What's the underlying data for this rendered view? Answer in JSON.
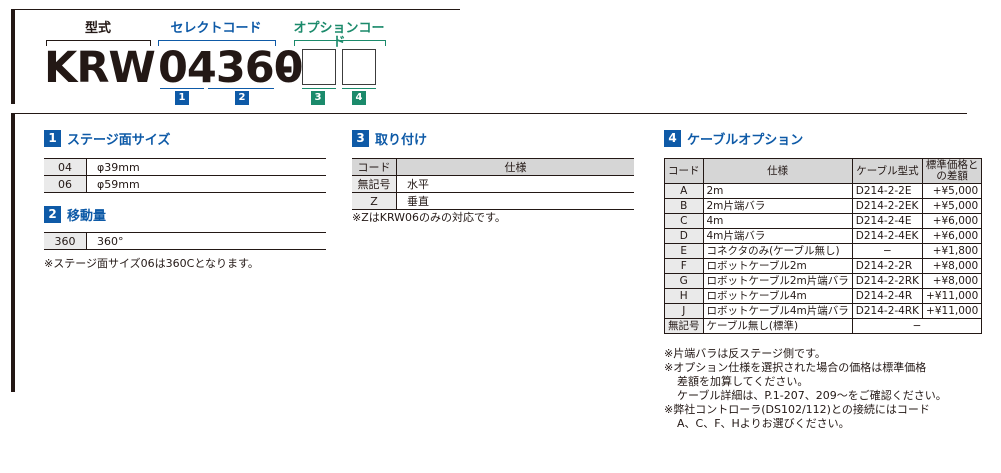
{
  "header": {
    "label_type": "型式",
    "label_select": "セレクトコード",
    "label_option": "オプションコード",
    "model_prefix": "KRW",
    "select_code": "04360",
    "dash": "-",
    "badge1": "1",
    "badge2": "2",
    "badge3": "3",
    "badge4": "4",
    "colors": {
      "blue": "#0e5aa7",
      "green": "#1b8a6b",
      "dark": "#231815"
    }
  },
  "stage_size": {
    "badge": "1",
    "title": "ステージ面サイズ",
    "rows": [
      {
        "code": "04",
        "value": "φ39mm"
      },
      {
        "code": "06",
        "value": "φ59mm"
      }
    ]
  },
  "travel": {
    "badge": "2",
    "title": "移動量",
    "rows": [
      {
        "code": "360",
        "value": "360°"
      }
    ],
    "note": "※ステージ面サイズ06は360Cとなります。"
  },
  "mounting": {
    "badge": "3",
    "title": "取り付け",
    "headers": {
      "code": "コード",
      "spec": "仕様"
    },
    "rows": [
      {
        "code": "無記号",
        "spec": "水平"
      },
      {
        "code": "Z",
        "spec": "垂直"
      }
    ],
    "note": "※ZはKRW06のみの対応です。"
  },
  "cable": {
    "badge": "4",
    "title": "ケーブルオプション",
    "headers": {
      "code": "コード",
      "spec": "仕様",
      "model": "ケーブル型式",
      "price": "標準価格との差額"
    },
    "rows": [
      {
        "code": "A",
        "spec": "2m",
        "model": "D214-2-2E",
        "price": "+¥5,000"
      },
      {
        "code": "B",
        "spec": "2m片端バラ",
        "model": "D214-2-2EK",
        "price": "+¥5,000"
      },
      {
        "code": "C",
        "spec": "4m",
        "model": "D214-2-4E",
        "price": "+¥6,000"
      },
      {
        "code": "D",
        "spec": "4m片端バラ",
        "model": "D214-2-4EK",
        "price": "+¥6,000"
      },
      {
        "code": "E",
        "spec": "コネクタのみ(ケーブル無し)",
        "model": "−",
        "price": "+¥1,800"
      },
      {
        "code": "F",
        "spec": "ロボットケーブル2m",
        "model": "D214-2-2R",
        "price": "+¥8,000"
      },
      {
        "code": "G",
        "spec": "ロボットケーブル2m片端バラ",
        "model": "D214-2-2RK",
        "price": "+¥8,000"
      },
      {
        "code": "H",
        "spec": "ロボットケーブル4m",
        "model": "D214-2-4R",
        "price": "+¥11,000"
      },
      {
        "code": "J",
        "spec": "ロボットケーブル4m片端バラ",
        "model": "D214-2-4RK",
        "price": "+¥11,000"
      }
    ],
    "last_row": {
      "code": "無記号",
      "spec": "ケーブル無し(標準)",
      "model_price": "−"
    },
    "notes": [
      "※片端バラは反ステージ側です。",
      "※オプション仕様を選択された場合の価格は標準価格",
      "差額を加算してください。",
      "ケーブル詳細は、P.1-207、209〜をご確認ください。",
      "※弊社コントローラ(DS102/112)との接続にはコード",
      "A、C、F、Hよりお選びください。"
    ]
  }
}
